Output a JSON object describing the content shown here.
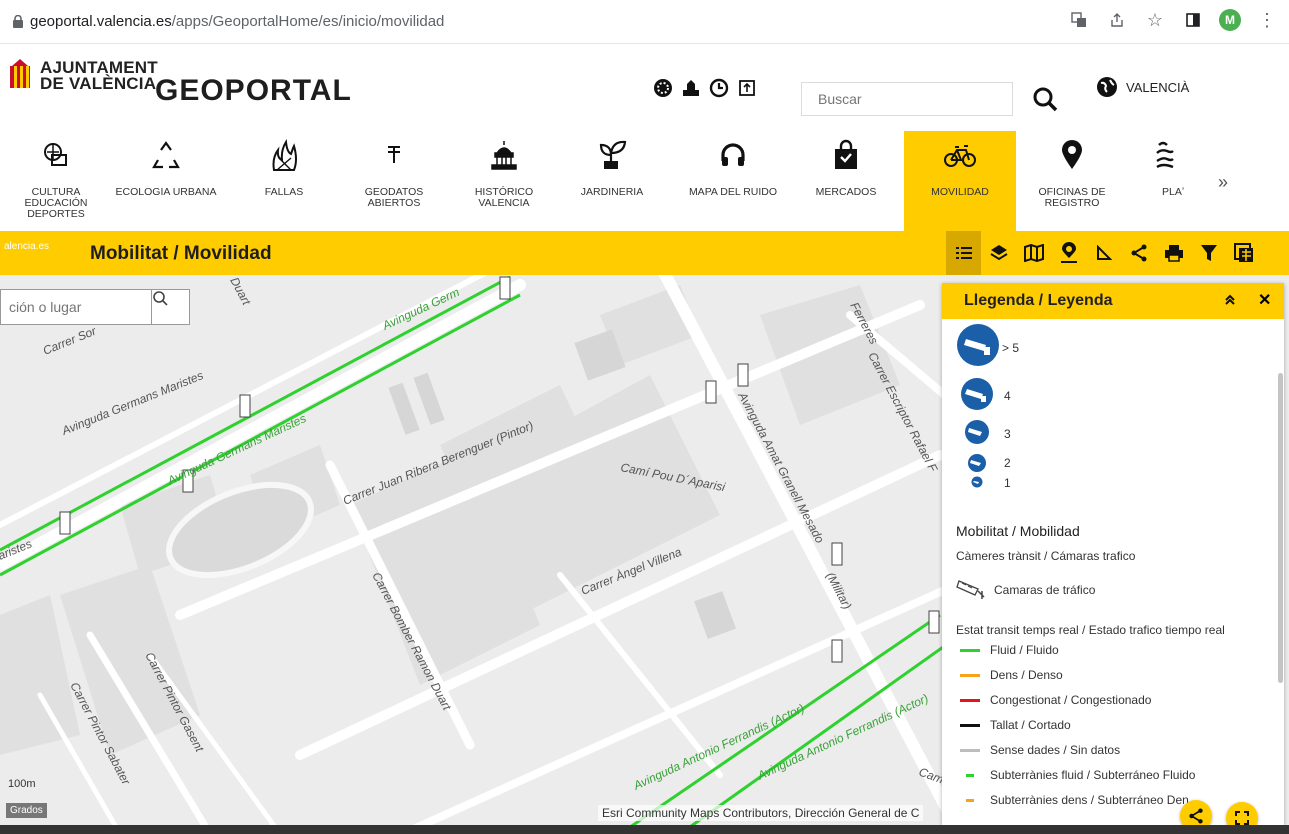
{
  "browser": {
    "url_host": "geoportal.valencia.es",
    "url_path": "/apps/GeoportalHome/es/inicio/movilidad",
    "avatar_letter": "M"
  },
  "header": {
    "logo_line1": "AJUNTAMENT",
    "logo_line2": "DE VALÈNCIA",
    "brand": "GEOPORTAL",
    "search_placeholder": "Buscar",
    "language": "VALENCIÀ"
  },
  "categories": [
    {
      "label": "CULTURA EDUCACIÓN DEPORTES",
      "icon": "culture-icon"
    },
    {
      "label": "ECOLOGIA URBANA",
      "icon": "recycle-icon"
    },
    {
      "label": "FALLAS",
      "icon": "fallas-icon"
    },
    {
      "label": "GEODATOS ABIERTOS",
      "icon": "open-data-icon"
    },
    {
      "label": "HISTÓRICO VALENCIA",
      "icon": "monument-icon"
    },
    {
      "label": "JARDINERIA",
      "icon": "plant-icon"
    },
    {
      "label": "MAPA DEL RUIDO",
      "icon": "headphones-icon"
    },
    {
      "label": "MERCADOS",
      "icon": "shopping-bag-icon"
    },
    {
      "label": "MOVILIDAD",
      "icon": "bicycle-icon"
    },
    {
      "label": "OFICINAS DE REGISTRO",
      "icon": "location-pin-icon"
    },
    {
      "label": "PLAʼ",
      "icon": "beach-icon"
    }
  ],
  "more_arrow": "»",
  "titlebar": {
    "site_tag": "alencia.es",
    "title": "Mobilitat / Movilidad"
  },
  "map": {
    "search_placeholder": "ción o lugar",
    "scale": "100m",
    "units": "Grados",
    "attribution": "Esri Community Maps Contributors, Dirección General de C",
    "streets": [
      "Carrer Juan Ribera Berenguer (Pintor)",
      "Camí Pou D´Aparisi",
      "Carrer Àngel Villena",
      "Avinguda Germans Maristes",
      "Avinguda Germans Maristes",
      "Avinguda Germ",
      "Avinguda Amat Granell Mesado",
      "(Militar)",
      "Carrer Escriptor Rafael F",
      "Carrer Bomber Ramon Duart",
      "Carrer Pintor Gasent",
      "Carrer Pintor Sabater",
      "Avinguda Antonio Ferrandis (Actor)",
      "Avinguda Antonio Ferrandis (Actor)",
      "Carrer Sor",
      "Ferreres",
      "Duart",
      "aristes",
      "Cam"
    ]
  },
  "legend": {
    "title": "Llegenda / Leyenda",
    "cam_sizes": [
      "> 5",
      "4",
      "3",
      "2",
      "1"
    ],
    "group_title": "Mobilitat / Mobilidad",
    "cams_subtitle": "Càmeres trànsit / Cámaras trafico",
    "cams_item": "Camaras de tráfico",
    "traffic_subtitle": "Estat transit temps real / Estado trafico tiempo real",
    "items": [
      {
        "label": "Fluid / Fluido",
        "color": "#2ed12e",
        "short": false
      },
      {
        "label": "Dens / Denso",
        "color": "#f7a21b",
        "short": false
      },
      {
        "label": "Congestionat / Congestionado",
        "color": "#e0161a",
        "short": false
      },
      {
        "label": "Tallat / Cortado",
        "color": "#111111",
        "short": false
      },
      {
        "label": "Sense dades / Sin datos",
        "color": "#bdbdbd",
        "short": false
      },
      {
        "label": "Subterrànies fluid / Subterráneo Fluido",
        "color": "#2ed12e",
        "short": true
      },
      {
        "label": "Subterrànies dens / Subterráneo Den",
        "color": "#f7a21b",
        "short": true
      }
    ]
  },
  "colors": {
    "accent": "#ffcc00",
    "accent_dark": "#d7a900",
    "fluid": "#2ed12e",
    "camera_blue": "#1a5fa8"
  }
}
